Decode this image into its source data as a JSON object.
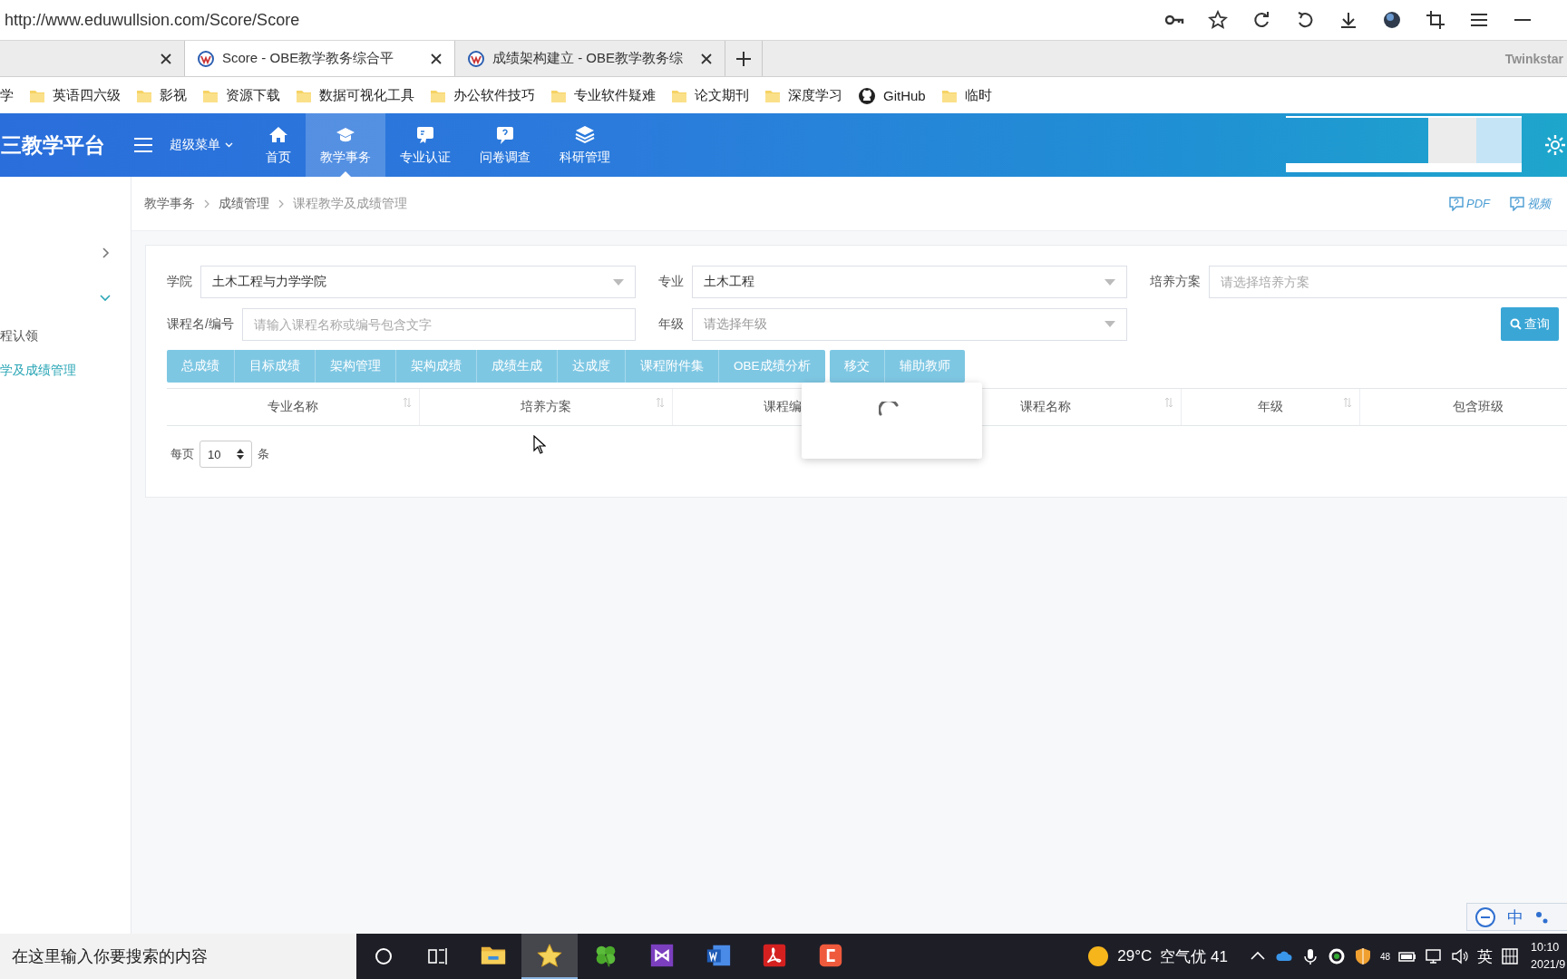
{
  "browser": {
    "url": "http://www.eduwullsion.com/Score/Score",
    "tabs": [
      {
        "selected": false
      },
      {
        "title": "Score - OBE教学教务综合平",
        "selected": true
      },
      {
        "title": "成绩架构建立 - OBE教学教务综",
        "selected": false
      }
    ],
    "brand": "Twinkstar",
    "bookmarks": [
      {
        "kind": "partial",
        "label": "学"
      },
      {
        "kind": "folder",
        "label": "英语四六级"
      },
      {
        "kind": "folder",
        "label": "影视"
      },
      {
        "kind": "folder",
        "label": "资源下载"
      },
      {
        "kind": "folder",
        "label": "数据可视化工具"
      },
      {
        "kind": "folder",
        "label": "办公软件技巧"
      },
      {
        "kind": "folder",
        "label": "专业软件疑难"
      },
      {
        "kind": "folder",
        "label": "论文期刊"
      },
      {
        "kind": "folder",
        "label": "深度学习"
      },
      {
        "kind": "github",
        "label": "GitHub"
      },
      {
        "kind": "folder",
        "label": "临时"
      }
    ]
  },
  "header": {
    "logo": "三教学平台",
    "super_menu": "超级菜单",
    "nav": [
      {
        "kind": "home",
        "label": "首页",
        "selected": false
      },
      {
        "kind": "school",
        "label": "教学事务",
        "selected": true
      },
      {
        "kind": "badge",
        "label": "专业认证",
        "selected": false
      },
      {
        "kind": "survey",
        "label": "问卷调查",
        "selected": false
      },
      {
        "kind": "layers",
        "label": "科研管理",
        "selected": false
      }
    ]
  },
  "sidebar": [
    {
      "kind": "group",
      "expanded": false
    },
    {
      "kind": "group",
      "expanded": true
    },
    {
      "kind": "link",
      "label": "程认领",
      "selected": false
    },
    {
      "kind": "link",
      "label": "学及成绩管理",
      "selected": true
    }
  ],
  "breadcrumb": [
    "教学事务",
    "成绩管理",
    "课程教学及成绩管理"
  ],
  "help_links": [
    "PDF",
    "视频"
  ],
  "filter_rows": [
    [
      {
        "kind": "select",
        "label": "学院",
        "value": "土木工程与力学学院"
      },
      {
        "kind": "select",
        "label": "专业",
        "value": "土木工程"
      },
      {
        "kind": "input",
        "label": "培养方案",
        "placeholder": "请选择培养方案"
      }
    ],
    [
      {
        "kind": "input",
        "label": "课程名/编号",
        "placeholder": "请输入课程名称或编号包含文字"
      },
      {
        "kind": "select",
        "label": "年级",
        "placeholder": "请选择年级"
      }
    ]
  ],
  "search_button": "查询",
  "action_groups": [
    [
      "总成绩",
      "目标成绩",
      "架构管理",
      "架构成绩",
      "成绩生成",
      "达成度",
      "课程附件集",
      "OBE成绩分析"
    ],
    [
      "移交",
      "辅助教师"
    ]
  ],
  "table": {
    "columns": [
      {
        "label": "专业名称",
        "sortable": true
      },
      {
        "label": "培养方案",
        "sortable": true
      },
      {
        "label": "课程编",
        "sortable": false
      },
      {
        "label": "课程名称",
        "sortable": true
      },
      {
        "label": "年级",
        "sortable": true
      },
      {
        "label": "包含班级",
        "sortable": false
      }
    ]
  },
  "loading": true,
  "pagination": {
    "prefix": "每页",
    "page_size": "10",
    "suffix": "条"
  },
  "taskbar": {
    "search_placeholder": "在这里输入你要搜索的内容",
    "apps": [
      {
        "kind": "folder",
        "selected": false
      },
      {
        "kind": "star",
        "selected": true
      },
      {
        "kind": "clover",
        "selected": false
      },
      {
        "kind": "studio",
        "selected": false
      },
      {
        "kind": "word",
        "selected": false
      },
      {
        "kind": "pdf",
        "selected": false
      },
      {
        "kind": "c-app",
        "selected": false
      }
    ],
    "temperature": "29°C",
    "air_quality": "空气优 41",
    "tray_number": "48",
    "input_language": "英",
    "time": "10:10",
    "date": "2021/9"
  },
  "ime_bar": {
    "language": "中"
  }
}
